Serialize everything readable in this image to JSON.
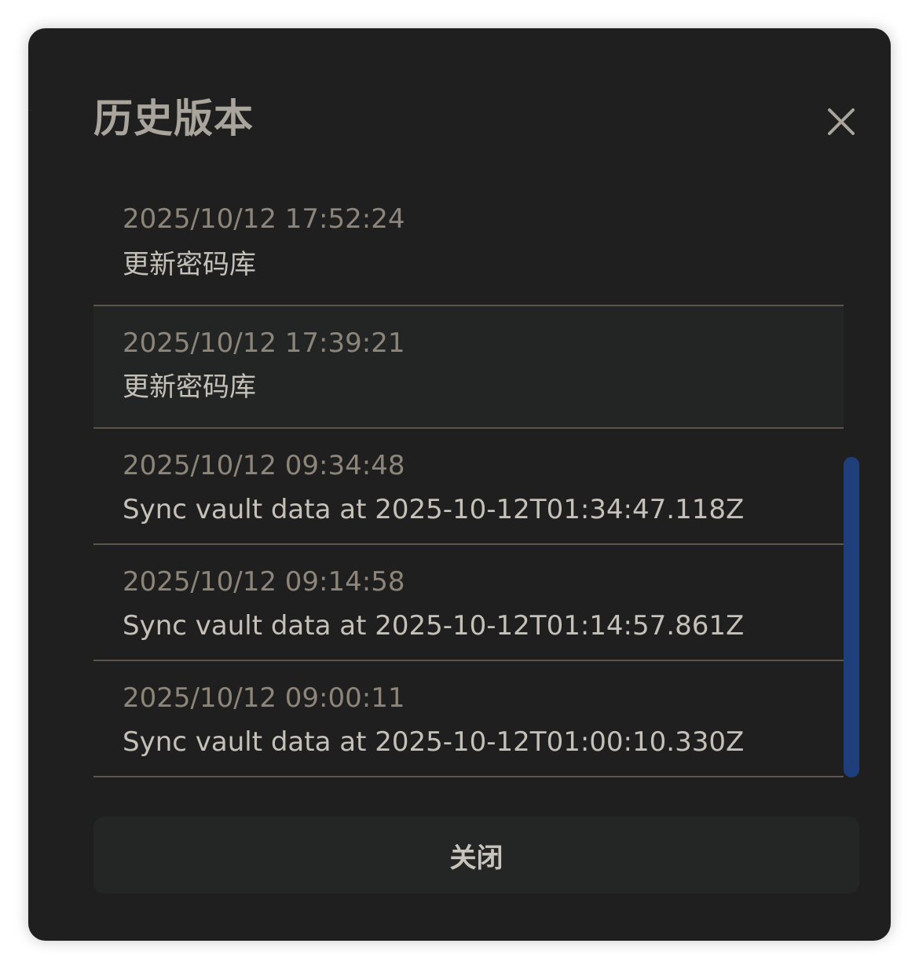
{
  "dialog": {
    "title": "历史版本",
    "close_icon": "close-icon",
    "versions": [
      {
        "time": "2025/10/12 17:52:24",
        "message": "更新密码库"
      },
      {
        "time": "2025/10/12 17:39:21",
        "message": "更新密码库"
      },
      {
        "time": "2025/10/12 09:34:48",
        "message": "Sync vault data at 2025-10-12T01:34:47.118Z"
      },
      {
        "time": "2025/10/12 09:14:58",
        "message": "Sync vault data at 2025-10-12T01:14:57.861Z"
      },
      {
        "time": "2025/10/12 09:00:11",
        "message": "Sync vault data at 2025-10-12T01:00:10.330Z"
      }
    ],
    "close_button_label": "关闭"
  },
  "colors": {
    "background": "#1f1f1f",
    "title": "#a9a49c",
    "time_text": "#8d857a",
    "message_text": "#c6c1b8",
    "divider": "#5b554c",
    "highlight_row": "#232525",
    "scrollbar": "#1e3f7c",
    "button_bg": "#242525"
  }
}
